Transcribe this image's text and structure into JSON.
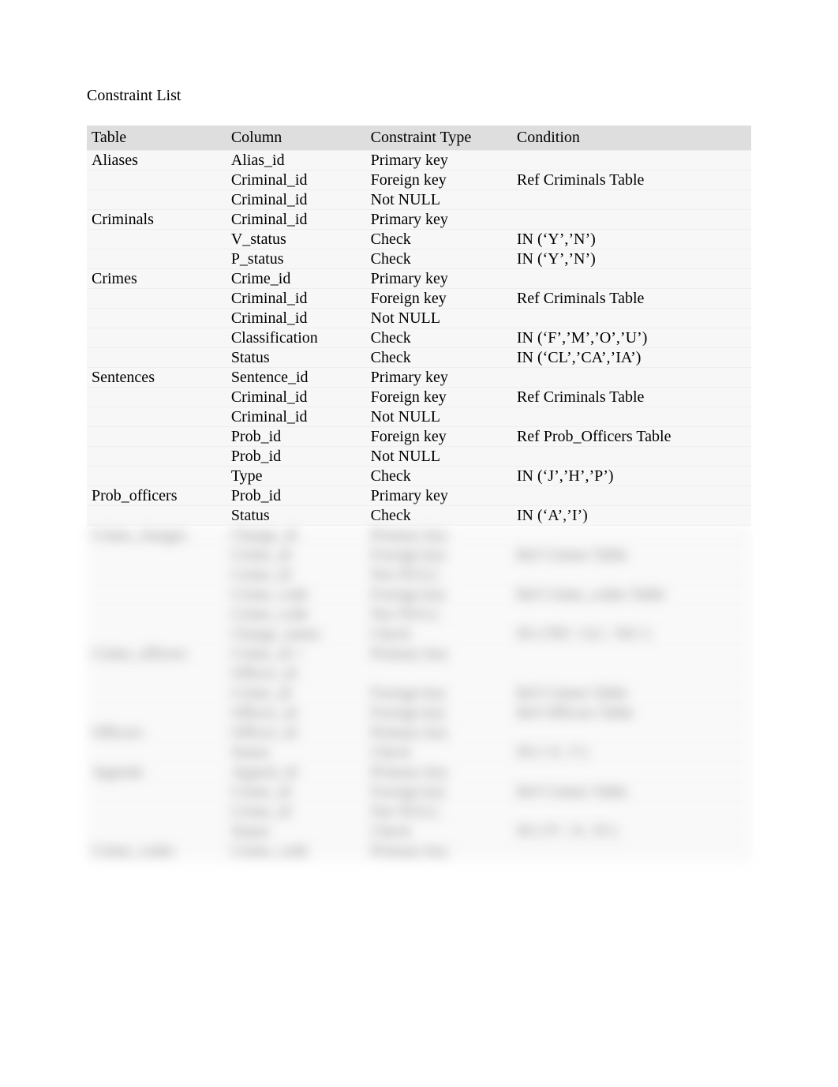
{
  "title": "Constraint List",
  "headers": {
    "table": "Table",
    "column": "Column",
    "constraint_type": "Constraint Type",
    "condition": "Condition"
  },
  "rows": [
    {
      "table": "Aliases",
      "column": "Alias_id",
      "ctype": "Primary key",
      "condition": ""
    },
    {
      "table": "",
      "column": "Criminal_id",
      "ctype": "Foreign key",
      "condition": "Ref Criminals Table"
    },
    {
      "table": "",
      "column": "Criminal_id",
      "ctype": "Not NULL",
      "condition": ""
    },
    {
      "table": "Criminals",
      "column": "Criminal_id",
      "ctype": "Primary key",
      "condition": ""
    },
    {
      "table": "",
      "column": "V_status",
      "ctype": "Check",
      "condition": "IN (‘Y’,’N’)"
    },
    {
      "table": "",
      "column": "P_status",
      "ctype": "Check",
      "condition": "IN (‘Y’,’N’)"
    },
    {
      "table": "Crimes",
      "column": "Crime_id",
      "ctype": "Primary key",
      "condition": ""
    },
    {
      "table": "",
      "column": "Criminal_id",
      "ctype": "Foreign key",
      "condition": "Ref Criminals Table"
    },
    {
      "table": "",
      "column": "Criminal_id",
      "ctype": "Not NULL",
      "condition": ""
    },
    {
      "table": "",
      "column": "Classification",
      "ctype": "Check",
      "condition": "IN (‘F’,’M’,’O’,’U’)"
    },
    {
      "table": "",
      "column": "Status",
      "ctype": "Check",
      "condition": "IN (‘CL’,’CA’,’IA’)"
    },
    {
      "table": "Sentences",
      "column": "Sentence_id",
      "ctype": "Primary key",
      "condition": ""
    },
    {
      "table": "",
      "column": "Criminal_id",
      "ctype": "Foreign key",
      "condition": "Ref Criminals Table"
    },
    {
      "table": "",
      "column": "Criminal_id",
      "ctype": "Not NULL",
      "condition": ""
    },
    {
      "table": "",
      "column": "Prob_id",
      "ctype": "Foreign key",
      "condition": "Ref Prob_Officers Table"
    },
    {
      "table": "",
      "column": "Prob_id",
      "ctype": "Not NULL",
      "condition": ""
    },
    {
      "table": "",
      "column": "Type",
      "ctype": "Check",
      "condition": "IN (‘J’,’H’,’P’)"
    },
    {
      "table": "Prob_officers",
      "column": "Prob_id",
      "ctype": "Primary key",
      "condition": ""
    },
    {
      "table": "",
      "column": "Status",
      "ctype": "Check",
      "condition": "IN (‘A’,’I’)"
    }
  ],
  "blurred_rows": [
    {
      "table": "Crime_charges",
      "column": "Charge_id",
      "ctype": "Primary key",
      "condition": ""
    },
    {
      "table": "",
      "column": "Crime_id",
      "ctype": "Foreign key",
      "condition": "Ref Crimes Table"
    },
    {
      "table": "",
      "column": "Crime_id",
      "ctype": "Not NULL",
      "condition": ""
    },
    {
      "table": "",
      "column": "Crime_code",
      "ctype": "Foreign key",
      "condition": "Ref Crime_codes Table"
    },
    {
      "table": "",
      "column": "Crime_code",
      "ctype": "Not NULL",
      "condition": ""
    },
    {
      "table": "",
      "column": "Charge_status",
      "ctype": "Check",
      "condition": "IN (‘PD’,’GL’,’NG’)"
    },
    {
      "table": "Crime_officers",
      "column": "Crime_id +",
      "ctype": "Primary key",
      "condition": ""
    },
    {
      "table": "",
      "column": "Officer_id",
      "ctype": "",
      "condition": ""
    },
    {
      "table": "",
      "column": "Crime_id",
      "ctype": "Foreign key",
      "condition": "Ref Crimes Table"
    },
    {
      "table": "",
      "column": "Officer_id",
      "ctype": "Foreign key",
      "condition": "Ref Officers Table"
    },
    {
      "table": "Officers",
      "column": "Officer_id",
      "ctype": "Primary key",
      "condition": ""
    },
    {
      "table": "",
      "column": "Status",
      "ctype": "Check",
      "condition": "IN (‘A’,’I’)"
    },
    {
      "table": "Appeals",
      "column": "Appeal_id",
      "ctype": "Primary key",
      "condition": ""
    },
    {
      "table": "",
      "column": "Crime_id",
      "ctype": "Foreign key",
      "condition": "Ref Crimes Table"
    },
    {
      "table": "",
      "column": "Crime_id",
      "ctype": "Not NULL",
      "condition": ""
    },
    {
      "table": "",
      "column": "Status",
      "ctype": "Check",
      "condition": "IN (‘P’,’A’,’D’)"
    },
    {
      "table": "Crime_codes",
      "column": "Crime_code",
      "ctype": "Primary key",
      "condition": ""
    }
  ]
}
